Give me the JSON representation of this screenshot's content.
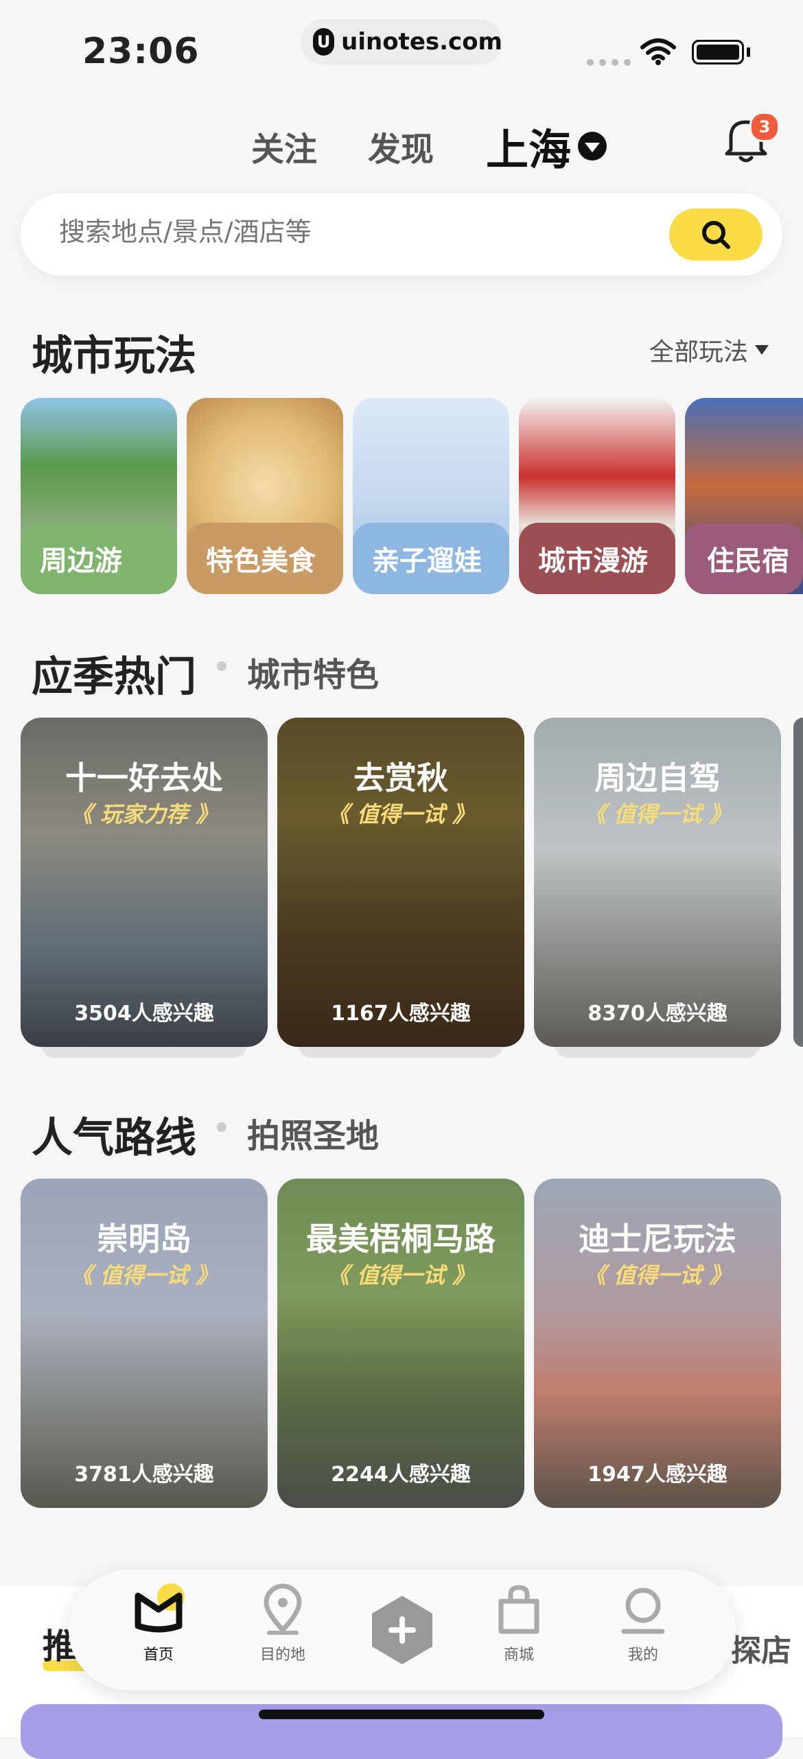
{
  "status_bar": {
    "time": "23:06",
    "url": "uinotes.com"
  },
  "header": {
    "tabs": [
      "关注",
      "发现"
    ],
    "city": "上海",
    "notification_count": "3"
  },
  "search": {
    "placeholder": "搜索地点/景点/酒店等"
  },
  "city_play": {
    "title": "城市玩法",
    "all_label": "全部玩法",
    "items": [
      {
        "label": "周边游",
        "color": "#7fb46d"
      },
      {
        "label": "特色美食",
        "color": "#c99a63"
      },
      {
        "label": "亲子遛娃",
        "color": "#8db7e0"
      },
      {
        "label": "城市漫游",
        "color": "#9b4f52"
      },
      {
        "label": "住民宿",
        "color": "#9a5c7a"
      }
    ]
  },
  "seasonal": {
    "title": "应季热门",
    "subtitle": "城市特色",
    "cards": [
      {
        "title": "十一好去处",
        "tag": "《 玩家力荐 》",
        "count": "3504人感兴趣"
      },
      {
        "title": "去赏秋",
        "tag": "《 值得一试 》",
        "count": "1167人感兴趣"
      },
      {
        "title": "周边自驾",
        "tag": "《 值得一试 》",
        "count": "8370人感兴趣"
      }
    ]
  },
  "routes": {
    "title": "人气路线",
    "subtitle": "拍照圣地",
    "cards": [
      {
        "title": "崇明岛",
        "tag": "《 值得一试 》",
        "count": "3781人感兴趣"
      },
      {
        "title": "最美梧桐马路",
        "tag": "《 值得一试 》",
        "count": "2244人感兴趣"
      },
      {
        "title": "迪士尼玩法",
        "tag": "《 值得一试 》",
        "count": "1947人感兴趣"
      }
    ]
  },
  "bottom": {
    "left_tab": "推",
    "right_tab": "探店"
  },
  "tabbar": {
    "items": [
      {
        "label": "首页",
        "icon": "home-m-icon"
      },
      {
        "label": "目的地",
        "icon": "location-pin-icon"
      },
      {
        "label": "",
        "icon": "plus-icon"
      },
      {
        "label": "商城",
        "icon": "shopping-bag-icon"
      },
      {
        "label": "我的",
        "icon": "user-icon"
      }
    ]
  }
}
